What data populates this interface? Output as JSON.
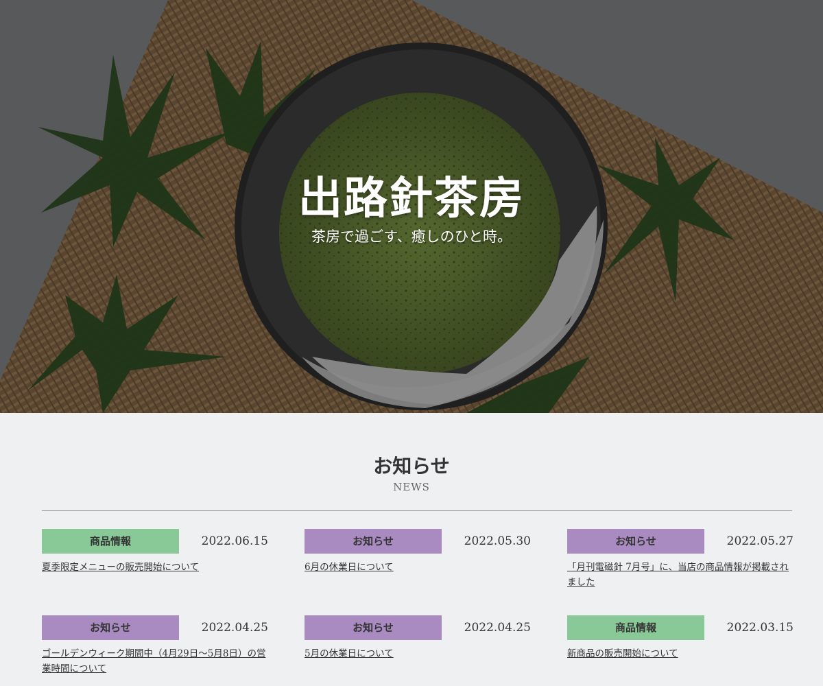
{
  "hero": {
    "title": "出路針茶房",
    "tagline": "茶房で過ごす、癒しのひと時。"
  },
  "news": {
    "title": "お知らせ",
    "subtitle": "NEWS",
    "items": [
      {
        "category": "商品情報",
        "category_color": "#89c997",
        "date": "2022.06.15",
        "text": "夏季限定メニューの販売開始について"
      },
      {
        "category": "お知らせ",
        "category_color": "#a98bc1",
        "date": "2022.05.30",
        "text": "6月の休業日について"
      },
      {
        "category": "お知らせ",
        "category_color": "#a98bc1",
        "date": "2022.05.27",
        "text": "「月刊電磁針 7月号」に、当店の商品情報が掲載されました"
      },
      {
        "category": "お知らせ",
        "category_color": "#a98bc1",
        "date": "2022.04.25",
        "text": "ゴールデンウィーク期間中（4月29日〜5月8日）の営業時間について"
      },
      {
        "category": "お知らせ",
        "category_color": "#a98bc1",
        "date": "2022.04.25",
        "text": "5月の休業日について"
      },
      {
        "category": "商品情報",
        "category_color": "#89c997",
        "date": "2022.03.15",
        "text": "新商品の販売開始について"
      }
    ]
  }
}
